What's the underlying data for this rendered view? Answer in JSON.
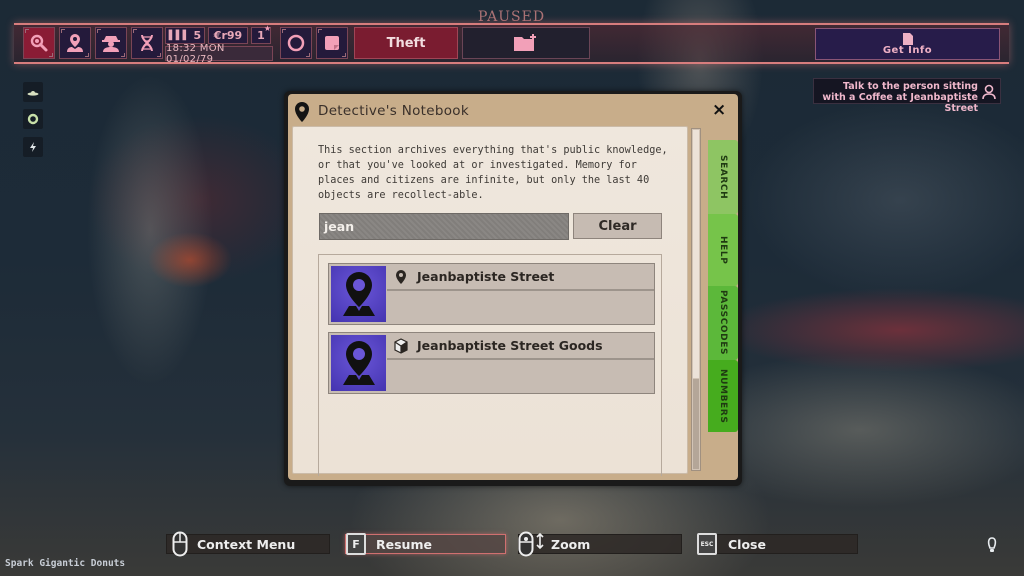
{
  "hud": {
    "paused_label": "PAUSED",
    "buttons": [
      {
        "name": "magnifier",
        "active": true
      },
      {
        "name": "location-person"
      },
      {
        "name": "detective-hat"
      },
      {
        "name": "dna"
      }
    ],
    "stats": {
      "energy_icon": "bars-icon",
      "energy_value": "5",
      "credits": "€r99",
      "lockpicks": "1",
      "clock": "18:32 MON 01/02/79"
    },
    "extra_buttons": [
      "circle",
      "sticky-notes"
    ],
    "case_label": "Theft",
    "case_folder_icon": "folder-plus-icon",
    "get_info_label": "Get Info",
    "objective": "Talk to the person sitting with a Coffee at Jeanbaptiste Street"
  },
  "left_icons": [
    "ufo-icon",
    "ring-icon",
    "lightning-icon"
  ],
  "notebook": {
    "title": "Detective's Notebook",
    "close_icon": "×",
    "description": "This section archives everything that's public knowledge, or that you've looked at or investigated. Memory for places and citizens are infinite, but only the last 40 objects are recollect-able.",
    "search_value": "jean",
    "clear_label": "Clear",
    "results": [
      {
        "title": "Jeanbaptiste Street",
        "type_icon": "location-pin-icon"
      },
      {
        "title": "Jeanbaptiste Street Goods",
        "type_icon": "box-icon"
      }
    ],
    "tabs": [
      "SEARCH",
      "HELP",
      "PASSCODES",
      "NUMBERS"
    ],
    "tab_colors": [
      "#8ec563",
      "#76c44a",
      "#5cb83a",
      "#46ac1e"
    ]
  },
  "bottom_bar": {
    "context_menu": "Context Menu",
    "resume_key": "F",
    "resume": "Resume",
    "zoom": "Zoom",
    "close_key": "ESC",
    "close": "Close"
  },
  "location_name": "Spark Gigantic Donuts",
  "colors": {
    "accent_pink": "#e8a8b8",
    "hud_dark": "#241a3b",
    "case_red": "#7a1c30",
    "result_thumb": "#5544c8"
  }
}
